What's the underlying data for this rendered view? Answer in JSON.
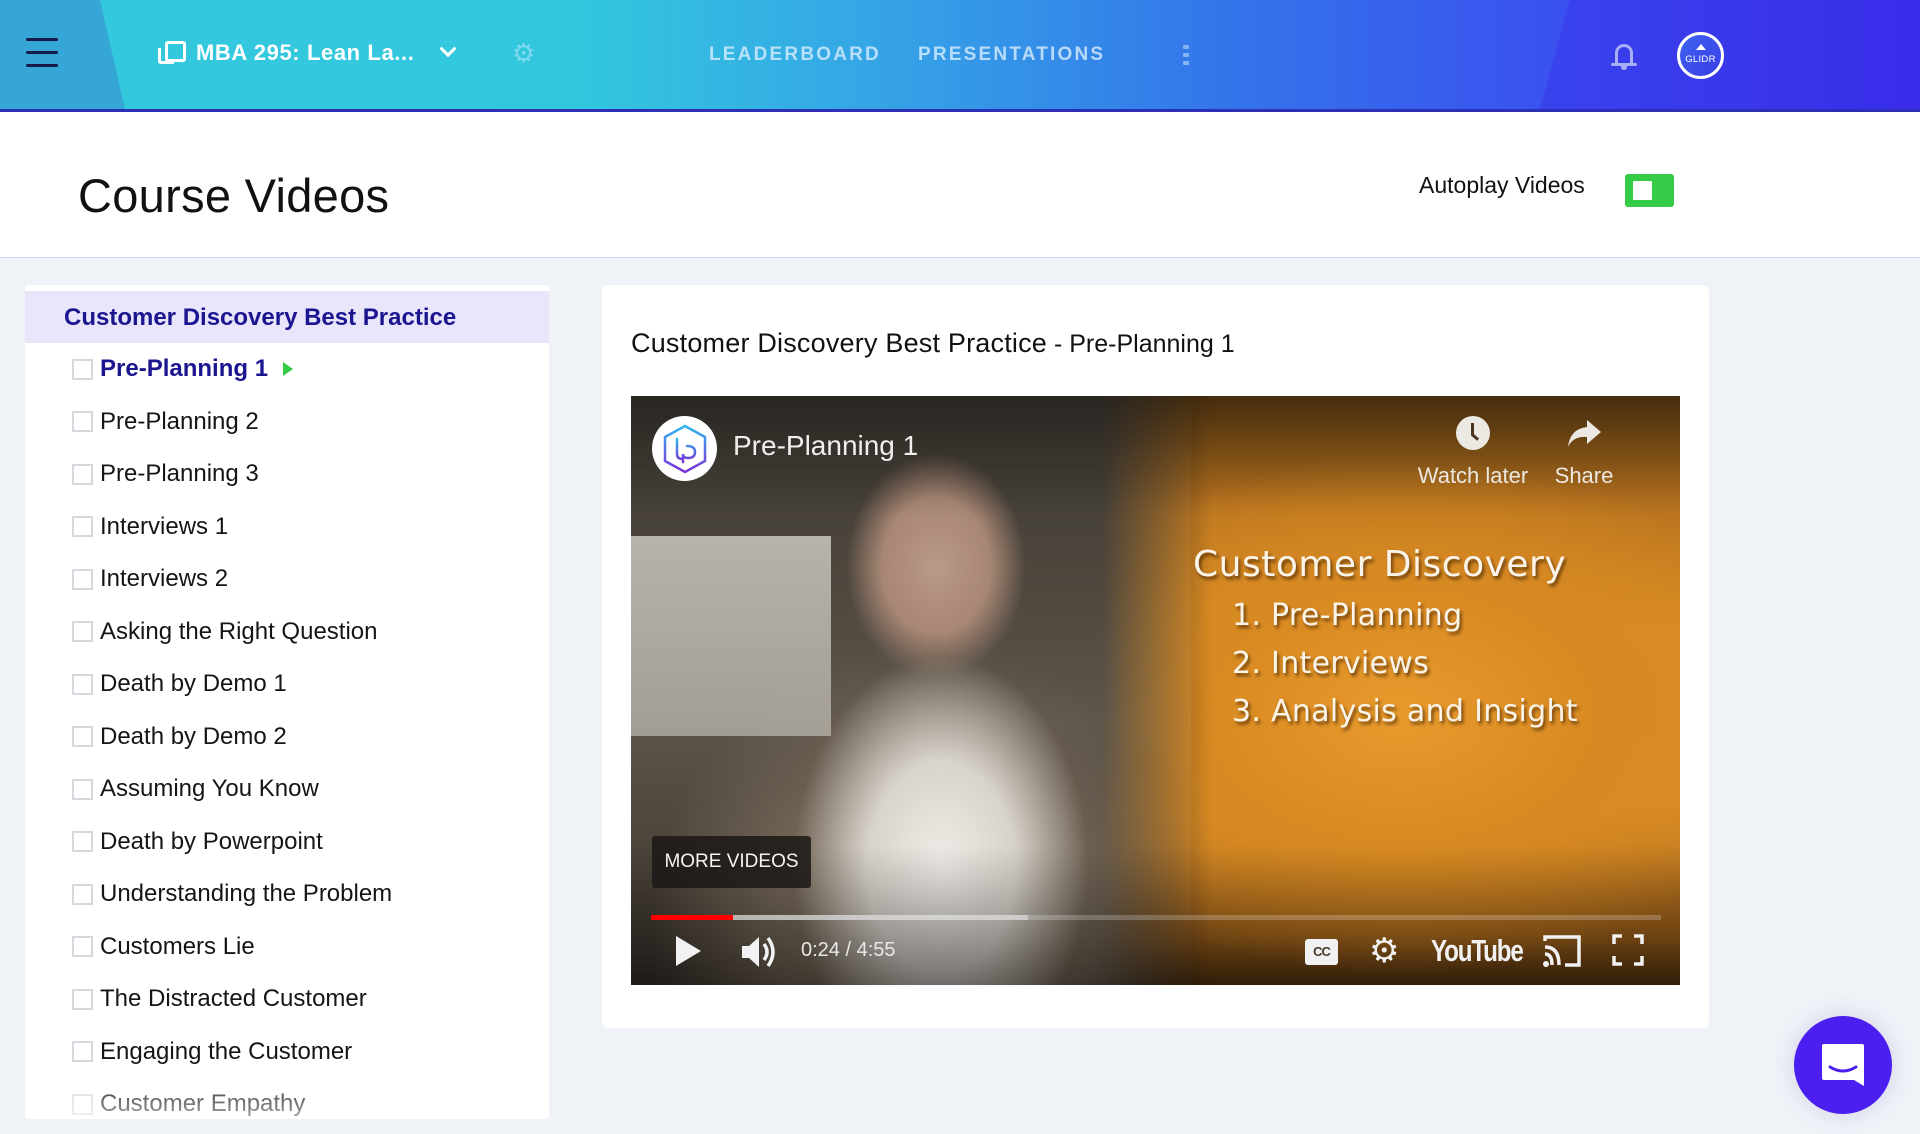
{
  "header": {
    "menu_icon": "hamburger-icon",
    "course_icon": "copy-icon",
    "course_name": "MBA 295: Lean La...",
    "course_dropdown_icon": "chevron-down-icon",
    "settings_icon": "gear-icon",
    "nav": [
      {
        "label": "LEADERBOARD"
      },
      {
        "label": "PRESENTATIONS"
      }
    ],
    "more_icon": "kebab-icon",
    "notifications_icon": "bell-icon",
    "avatar_label": "GLIDR"
  },
  "page": {
    "title": "Course Videos",
    "autoplay_label": "Autoplay Videos",
    "autoplay_on": true
  },
  "sidebar": {
    "section_title": "Customer Discovery Best Practice",
    "items": [
      {
        "label": "Pre-Planning 1",
        "active": true,
        "checked": false
      },
      {
        "label": "Pre-Planning 2",
        "checked": false
      },
      {
        "label": "Pre-Planning 3",
        "checked": false
      },
      {
        "label": "Interviews 1",
        "checked": false
      },
      {
        "label": "Interviews 2",
        "checked": false
      },
      {
        "label": "Asking the Right Question",
        "checked": false
      },
      {
        "label": "Death by Demo 1",
        "checked": false
      },
      {
        "label": "Death by Demo 2",
        "checked": false
      },
      {
        "label": "Assuming You Know",
        "checked": false
      },
      {
        "label": "Death by Powerpoint",
        "checked": false
      },
      {
        "label": "Understanding the Problem",
        "checked": false
      },
      {
        "label": "Customers Lie",
        "checked": false
      },
      {
        "label": "The Distracted Customer",
        "checked": false
      },
      {
        "label": "Engaging the Customer",
        "checked": false
      },
      {
        "label": "Customer Empathy",
        "checked": false
      }
    ]
  },
  "content": {
    "title_main": "Customer Discovery Best Practice",
    "title_separator": " - ",
    "title_sub": "Pre-Planning 1"
  },
  "player": {
    "video_title": "Pre-Planning 1",
    "watch_later_label": "Watch later",
    "share_label": "Share",
    "slide": {
      "heading": "Customer Discovery",
      "items": [
        "1. Pre-Planning",
        "2. Interviews",
        "3. Analysis and Insight"
      ]
    },
    "more_videos_label": "MORE VIDEOS",
    "current_time": "0:24",
    "duration": "4:55",
    "time_display": "0:24 / 4:55",
    "played_fraction": 0.081,
    "buffered_fraction": 0.373,
    "cc_label": "CC",
    "brand_label": "YouTube",
    "colors": {
      "progress": "#ff0000"
    }
  },
  "colors": {
    "accent": "#1c1590",
    "toggle_on": "#35cc47",
    "chat_button": "#4a1ff0"
  }
}
